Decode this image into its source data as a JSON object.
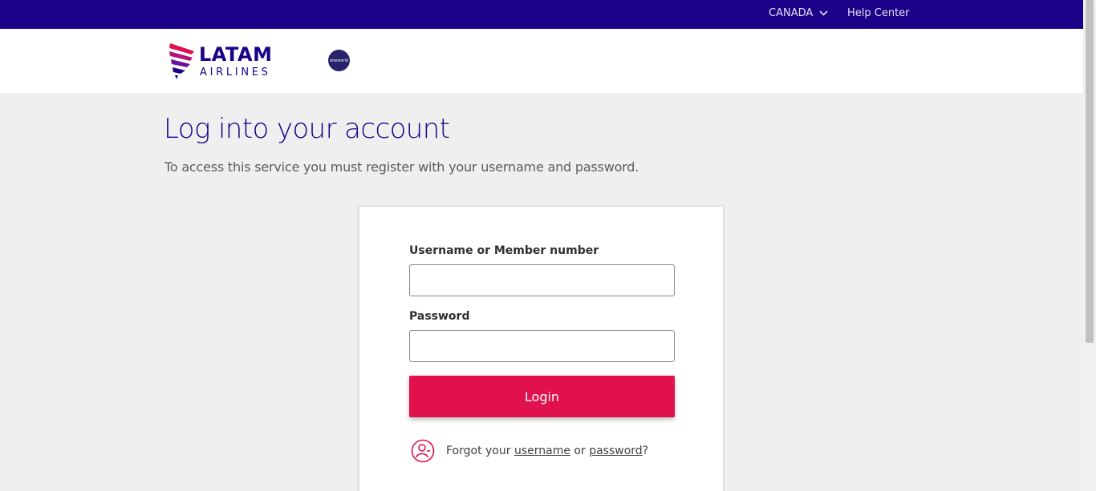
{
  "topbar": {
    "country": "CANADA",
    "help": "Help Center"
  },
  "header": {
    "logo_line1": "LATAM",
    "logo_line2": "AIRLINES",
    "oneworld": "oneworld"
  },
  "page": {
    "title": "Log into your account",
    "subtitle": "To access this service you must register with your username and password."
  },
  "form": {
    "username_label": "Username or Member number",
    "username_value": "",
    "password_label": "Password",
    "password_value": "",
    "login_label": "Login",
    "forgot_prefix": "Forgot your ",
    "forgot_username": "username",
    "forgot_or": " or ",
    "forgot_password": "password",
    "forgot_suffix": "?"
  },
  "colors": {
    "brand_indigo": "#1b0088",
    "brand_red": "#e0114c",
    "background": "#efefef"
  }
}
